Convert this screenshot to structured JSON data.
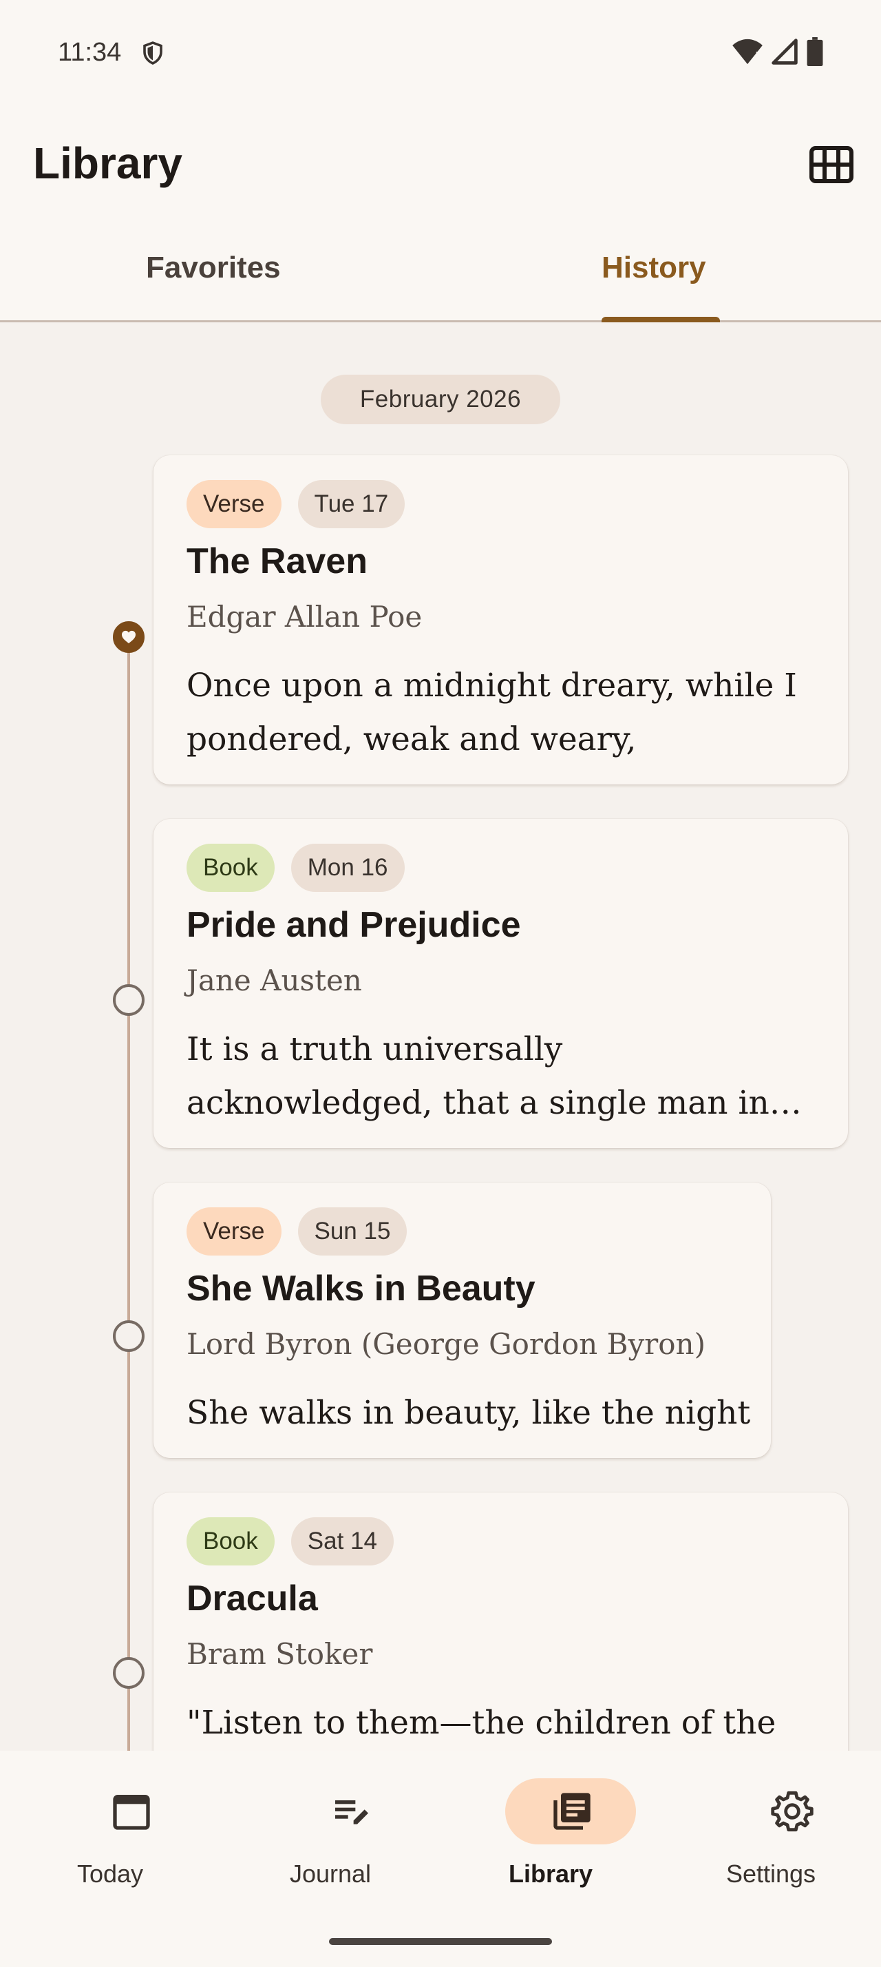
{
  "status_bar": {
    "time": "11:34"
  },
  "header": {
    "title": "Library"
  },
  "tabs": [
    {
      "label": "Favorites",
      "selected": false
    },
    {
      "label": "History",
      "selected": true
    }
  ],
  "month": "February 2026",
  "entries": [
    {
      "type": "Verse",
      "date": "Tue 17",
      "title": "The Raven",
      "author": "Edgar Allan Poe",
      "excerpt": "Once upon a midnight dreary, while I pondered, weak and weary,",
      "favorite": true
    },
    {
      "type": "Book",
      "date": "Mon 16",
      "title": "Pride and Prejudice",
      "author": "Jane Austen",
      "excerpt": "It is a truth universally acknowledged, that a single man in possession of a good fortune, must be in want of a wife.",
      "favorite": false
    },
    {
      "type": "Verse",
      "date": "Sun 15",
      "title": "She Walks in Beauty",
      "author": "Lord Byron (George Gordon Byron)",
      "excerpt": "She walks in beauty, like the night",
      "favorite": false
    },
    {
      "type": "Book",
      "date": "Sat 14",
      "title": "Dracula",
      "author": "Bram Stoker",
      "excerpt": "\"Listen to them—the children of the",
      "favorite": false
    }
  ],
  "nav": [
    {
      "label": "Today",
      "icon": "calendar-icon",
      "selected": false
    },
    {
      "label": "Journal",
      "icon": "edit-notes-icon",
      "selected": false
    },
    {
      "label": "Library",
      "icon": "library-books-icon",
      "selected": true
    },
    {
      "label": "Settings",
      "icon": "gear-icon",
      "selected": false
    }
  ],
  "colors": {
    "accent": "#8a5a1e",
    "verse_chip": "#fdd9bd",
    "book_chip": "#dde8b7",
    "date_chip": "#ecdfd5",
    "background": "#f5f1ed"
  }
}
